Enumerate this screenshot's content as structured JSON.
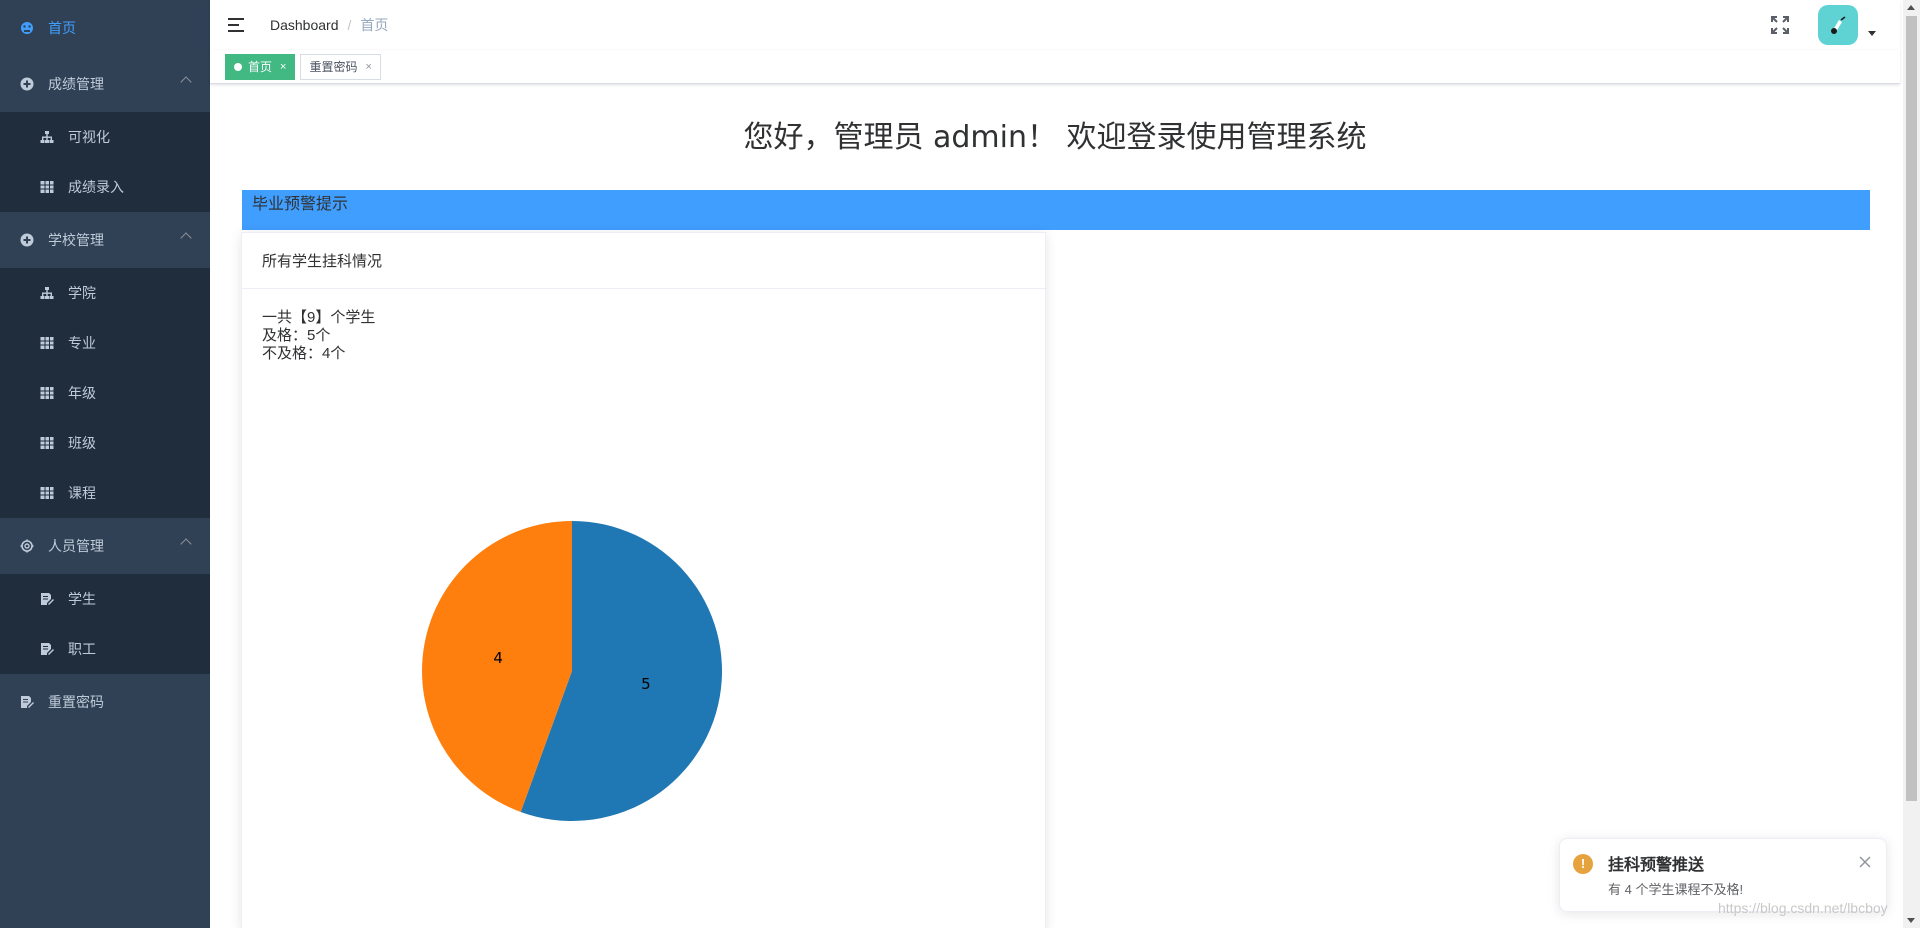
{
  "sidebar": {
    "items": [
      {
        "label": "首页",
        "icon": "dashboard-icon",
        "active": true
      },
      {
        "label": "成绩管理",
        "icon": "plus-circle-icon",
        "children": [
          {
            "label": "可视化",
            "icon": "tree-icon"
          },
          {
            "label": "成绩录入",
            "icon": "table-icon"
          }
        ]
      },
      {
        "label": "学校管理",
        "icon": "plus-circle-icon",
        "children": [
          {
            "label": "学院",
            "icon": "tree-icon"
          },
          {
            "label": "专业",
            "icon": "table-icon"
          },
          {
            "label": "年级",
            "icon": "table-icon"
          },
          {
            "label": "班级",
            "icon": "table-icon"
          },
          {
            "label": "课程",
            "icon": "table-icon"
          }
        ]
      },
      {
        "label": "人员管理",
        "icon": "gear-icon",
        "children": [
          {
            "label": "学生",
            "icon": "edit-doc-icon"
          },
          {
            "label": "职工",
            "icon": "edit-doc-icon"
          }
        ]
      },
      {
        "label": "重置密码",
        "icon": "edit-doc-icon"
      }
    ]
  },
  "header": {
    "breadcrumb_root": "Dashboard",
    "breadcrumb_sep": "/",
    "breadcrumb_current": "首页"
  },
  "tags": [
    {
      "label": "首页",
      "active": true,
      "close": "×"
    },
    {
      "label": "重置密码",
      "active": false,
      "close": "×"
    }
  ],
  "main": {
    "welcome": "您好，管理员 admin！ 欢迎登录使用管理系统",
    "warning_bar_label": "毕业预警提示",
    "card": {
      "title": "所有学生挂科情况",
      "summary_total": "一共【9】个学生",
      "summary_pass": "及格：5个",
      "summary_fail": "不及格：4个"
    }
  },
  "chart_data": {
    "type": "pie",
    "slices": [
      {
        "label": "5",
        "value": 5,
        "color": "#1f77b4"
      },
      {
        "label": "4",
        "value": 4,
        "color": "#ff7f0e"
      }
    ],
    "start_angle_deg": -90,
    "direction": "clockwise"
  },
  "notification": {
    "icon_text": "!",
    "title": "挂科预警推送",
    "message": "有 4 个学生课程不及格!"
  },
  "watermark": "https://blog.csdn.net/lbcboy",
  "colors": {
    "sidebar_bg": "#304156",
    "submenu_bg": "#1f2d3d",
    "active": "#409eff",
    "tag_active": "#42b983",
    "warn_bar": "#409eff",
    "notify_warning": "#e6a23c"
  }
}
